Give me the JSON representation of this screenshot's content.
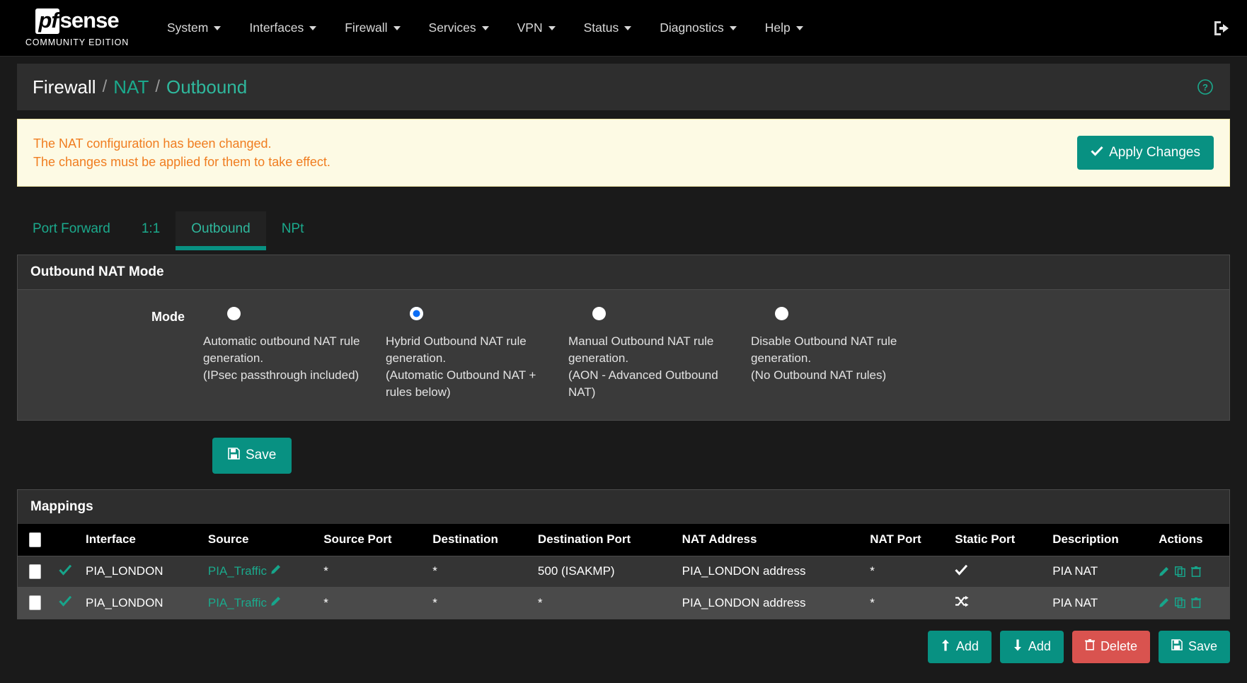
{
  "navbar": {
    "logo": {
      "pf": "pf",
      "sense": "sense",
      "subtitle": "COMMUNITY EDITION"
    },
    "menu": [
      {
        "label": "System",
        "icon": "chevron-down-icon"
      },
      {
        "label": "Interfaces",
        "icon": "chevron-down-icon"
      },
      {
        "label": "Firewall",
        "icon": "chevron-down-icon"
      },
      {
        "label": "Services",
        "icon": "chevron-down-icon"
      },
      {
        "label": "VPN",
        "icon": "chevron-down-icon"
      },
      {
        "label": "Status",
        "icon": "chevron-down-icon"
      },
      {
        "label": "Diagnostics",
        "icon": "chevron-down-icon"
      },
      {
        "label": "Help",
        "icon": "chevron-down-icon"
      }
    ],
    "logout_icon": "sign-out-icon"
  },
  "breadcrumb": {
    "root": "Firewall",
    "separator": "/",
    "level2": "NAT",
    "level3": "Outbound",
    "help_icon": "question-circle-icon"
  },
  "alert": {
    "line1": "The NAT configuration has been changed.",
    "line2": "The changes must be applied for them to take effect.",
    "apply_label": "Apply Changes",
    "apply_icon": "check-icon",
    "text_color": "#f07d20",
    "background": "#fdfae4"
  },
  "tabs": [
    {
      "label": "Port Forward",
      "active": false
    },
    {
      "label": "1:1",
      "active": false
    },
    {
      "label": "Outbound",
      "active": true
    },
    {
      "label": "NPt",
      "active": false
    }
  ],
  "outbound_nat_mode": {
    "panel_title": "Outbound NAT Mode",
    "field_label": "Mode",
    "options": [
      {
        "selected": false,
        "lines": [
          "Automatic outbound NAT rule",
          "generation.",
          "(IPsec passthrough included)"
        ]
      },
      {
        "selected": true,
        "lines": [
          "Hybrid Outbound NAT rule",
          "generation.",
          "(Automatic Outbound NAT +",
          "rules below)"
        ]
      },
      {
        "selected": false,
        "lines": [
          "Manual Outbound NAT rule",
          "generation.",
          "(AON - Advanced Outbound",
          "NAT)"
        ]
      },
      {
        "selected": false,
        "lines": [
          "Disable Outbound NAT rule",
          "generation.",
          "(No Outbound NAT rules)"
        ]
      }
    ],
    "save_label": "Save",
    "save_icon": "floppy-disk-icon"
  },
  "mappings": {
    "title": "Mappings",
    "select_all_icon": "checkbox-icon",
    "columns": [
      "",
      "",
      "Interface",
      "Source",
      "Source Port",
      "Destination",
      "Destination Port",
      "NAT Address",
      "NAT Port",
      "Static Port",
      "Description",
      "Actions"
    ],
    "rows": [
      {
        "checkbox_icon": "checkbox-icon",
        "state_icon": "check-icon",
        "interface": "PIA_LONDON",
        "source": "PIA_Traffic",
        "source_edit_icon": "pencil-icon",
        "source_port": "*",
        "destination": "*",
        "destination_port": "500 (ISAKMP)",
        "nat_address": "PIA_LONDON address",
        "nat_port": "*",
        "static_port_icon": "check-icon",
        "description": "PIA NAT",
        "actions": [
          "pencil-icon",
          "copy-icon",
          "trash-icon"
        ]
      },
      {
        "checkbox_icon": "checkbox-icon",
        "state_icon": "check-icon",
        "interface": "PIA_LONDON",
        "source": "PIA_Traffic",
        "source_edit_icon": "pencil-icon",
        "source_port": "*",
        "destination": "*",
        "destination_port": "*",
        "nat_address": "PIA_LONDON address",
        "nat_port": "*",
        "static_port_icon": "shuffle-icon",
        "description": "PIA NAT",
        "actions": [
          "pencil-icon",
          "copy-icon",
          "trash-icon"
        ]
      }
    ],
    "footer_buttons": [
      {
        "label": "Add",
        "icon": "arrow-up-icon",
        "style": "teal"
      },
      {
        "label": "Add",
        "icon": "arrow-down-icon",
        "style": "teal"
      },
      {
        "label": "Delete",
        "icon": "trash-icon",
        "style": "red"
      },
      {
        "label": "Save",
        "icon": "floppy-disk-icon",
        "style": "teal"
      }
    ]
  },
  "theme": {
    "accent_teal": "#089182",
    "link_teal": "#1ba98c",
    "danger_red": "#d9534f",
    "radio_blue": "#0b6ef6",
    "alert_orange": "#f07d20"
  }
}
